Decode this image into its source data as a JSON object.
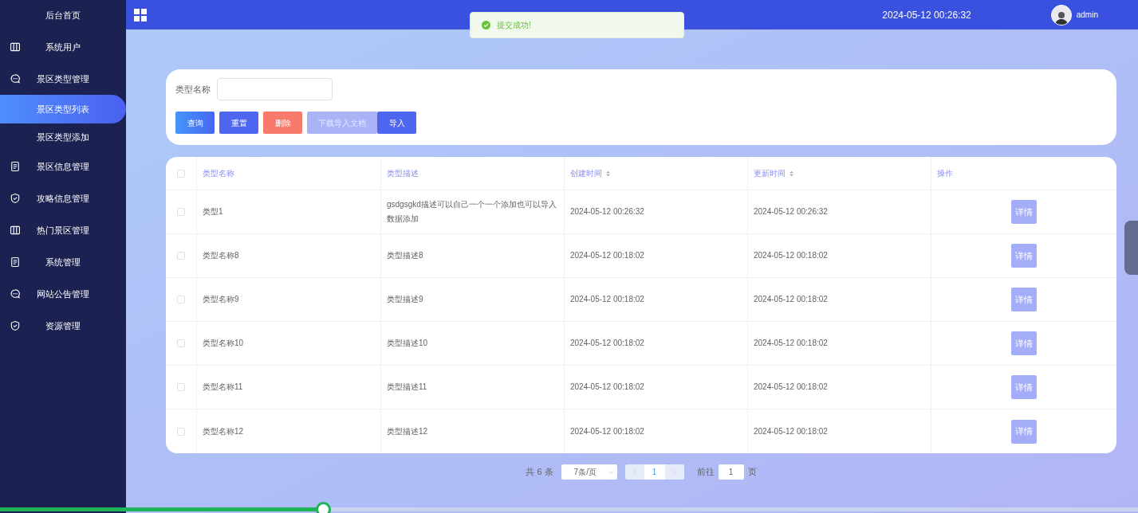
{
  "sidebar": {
    "home": "后台首页",
    "items": [
      {
        "label": "系统用户"
      },
      {
        "label": "景区类型管理",
        "children": [
          {
            "label": "景区类型列表",
            "selected": true
          },
          {
            "label": "景区类型添加",
            "selected": false
          }
        ]
      },
      {
        "label": "景区信息管理"
      },
      {
        "label": "攻略信息管理"
      },
      {
        "label": "热门景区管理"
      },
      {
        "label": "系统管理"
      },
      {
        "label": "网站公告管理"
      },
      {
        "label": "资源管理"
      }
    ]
  },
  "header": {
    "datetime": "2024-05-12 00:26:32",
    "user": "admin"
  },
  "toast": {
    "kind": "success",
    "text": "提交成功!"
  },
  "search": {
    "label": "类型名称",
    "buttons": [
      {
        "label": "查询",
        "kind": "primary"
      },
      {
        "label": "重置",
        "kind": "secondary"
      },
      {
        "label": "删除",
        "kind": "danger"
      },
      {
        "label": "下载导入文档",
        "kind": "light"
      },
      {
        "label": "导入",
        "kind": "secondary"
      }
    ]
  },
  "table": {
    "select_all": false,
    "columns": [
      {
        "label": "类型名称",
        "sortable": false
      },
      {
        "label": "类型描述",
        "sortable": false
      },
      {
        "label": "创建时间",
        "sortable": true
      },
      {
        "label": "更新时间",
        "sortable": true
      },
      {
        "label": "操作",
        "sortable": false
      }
    ],
    "rows": [
      {
        "selected": false,
        "cells": [
          "类型1",
          "gsdgsgkd描述可以自己一个一个添加也可以导入数据添加",
          "2024-05-12 00:26:32",
          "2024-05-12 00:26:32"
        ],
        "action": "详情"
      },
      {
        "selected": false,
        "cells": [
          "类型名称8",
          "类型描述8",
          "2024-05-12 00:18:02",
          "2024-05-12 00:18:02"
        ],
        "action": "详情"
      },
      {
        "selected": false,
        "cells": [
          "类型名称9",
          "类型描述9",
          "2024-05-12 00:18:02",
          "2024-05-12 00:18:02"
        ],
        "action": "详情"
      },
      {
        "selected": false,
        "cells": [
          "类型名称10",
          "类型描述10",
          "2024-05-12 00:18:02",
          "2024-05-12 00:18:02"
        ],
        "action": "详情"
      },
      {
        "selected": false,
        "cells": [
          "类型名称11",
          "类型描述11",
          "2024-05-12 00:18:02",
          "2024-05-12 00:18:02"
        ],
        "action": "详情"
      },
      {
        "selected": false,
        "cells": [
          "类型名称12",
          "类型描述12",
          "2024-05-12 00:18:02",
          "2024-05-12 00:18:02"
        ],
        "action": "详情"
      }
    ]
  },
  "pagination": {
    "total": "共 6 条",
    "page_size": "7条/页",
    "pages": [
      {
        "label": "1",
        "selected": true
      }
    ],
    "goto_label": "前往",
    "goto_value": "1",
    "goto_suffix": "页"
  },
  "video_progress": {
    "level": 0.284
  }
}
